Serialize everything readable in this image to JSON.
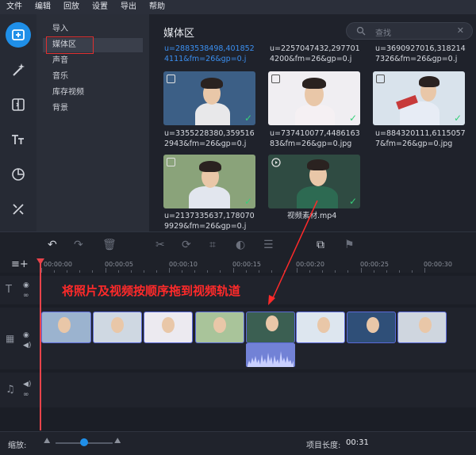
{
  "menu": [
    "文件",
    "编辑",
    "回放",
    "设置",
    "导出",
    "帮助"
  ],
  "left_tools": [
    "import-icon",
    "magic-wand-icon",
    "transition-icon",
    "text-icon",
    "sticker-icon",
    "tools-icon"
  ],
  "subnav": [
    "导入",
    "媒体区",
    "声音",
    "音乐",
    "库存视频",
    "背景"
  ],
  "library": {
    "title": "媒体区",
    "search_placeholder": "查找",
    "top_captions": [
      "u=2883538498,4018524111&fm=26&gp=0.j",
      "u=2257047432,2977014200&fm=26&gp=0.j",
      "u=3690927016,3182147326&fm=26&gp=0.j"
    ],
    "items": [
      "u=3355228380,3595162943&fm=26&gp=0.j",
      "u=737410077,448616383&fm=26&gp=0.jpg",
      "u=884320111,61150577&fm=26&gp=0.jpg",
      "u=2137335637,1780709929&fm=26&gp=0.j",
      "视频素材.mp4"
    ]
  },
  "ruler_labels": [
    "00:00:00",
    "00:00:05",
    "00:00:10",
    "00:00:15",
    "00:00:20",
    "00:00:25",
    "00:00:30"
  ],
  "annotation": "将照片及视频按顺序拖到视频轨道",
  "footer": {
    "zoom_label": "缩放:",
    "zoom_level": 0.5,
    "duration_label": "项目长度:",
    "duration_value": "00:31"
  },
  "colors": {
    "accent": "#1f8fe8",
    "check": "#36d07a",
    "annotation": "#ff2a2a",
    "clip_border": "#5b6ad8"
  }
}
